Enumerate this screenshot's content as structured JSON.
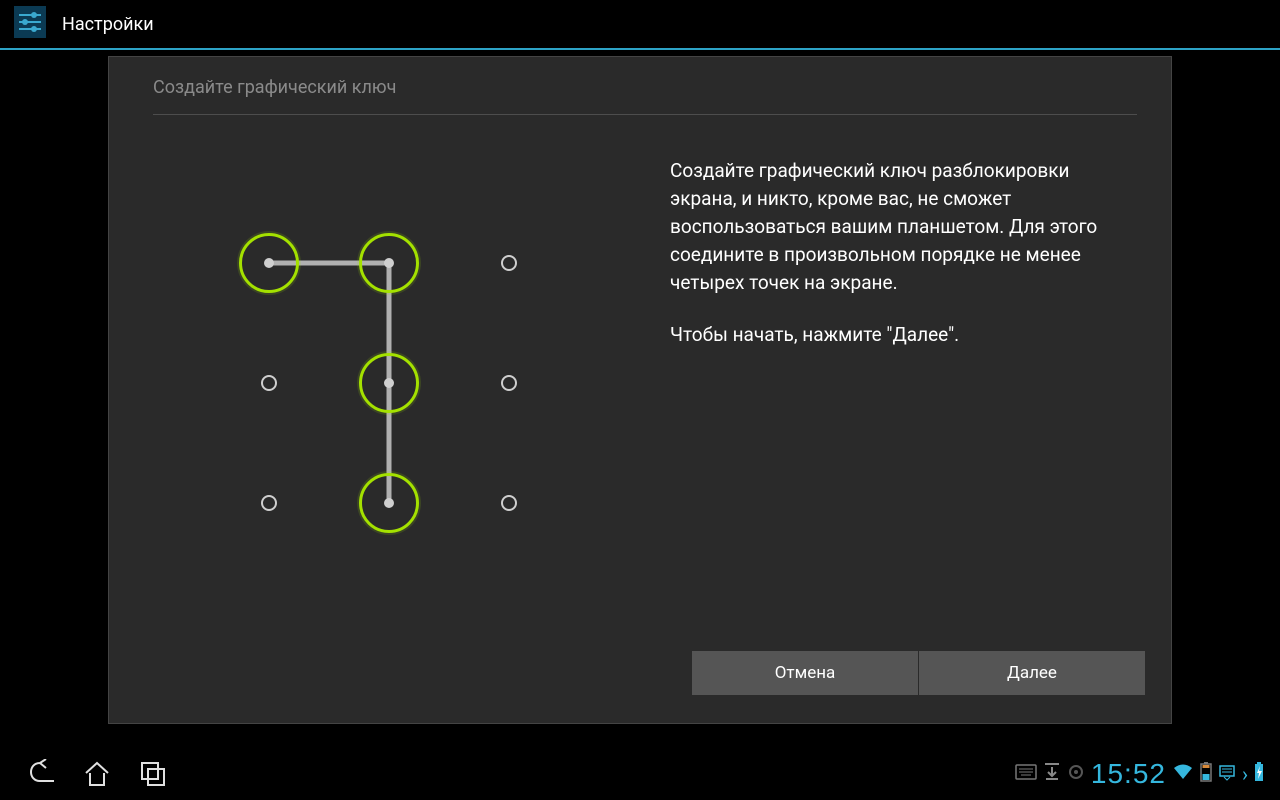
{
  "header": {
    "title": "Настройки"
  },
  "panel": {
    "heading": "Создайте графический ключ",
    "instruction1": "Создайте графический ключ разблокировки экрана, и никто, кроме вас, не сможет воспользоваться вашим планшетом. Для этого соедините в произвольном порядке не менее четырех точек на экране.",
    "instruction2": "Чтобы начать, нажмите \"Далее\"."
  },
  "buttons": {
    "cancel": "Отмена",
    "next": "Далее"
  },
  "pattern": {
    "grid": 3,
    "selected_indices": [
      0,
      1,
      4,
      7
    ],
    "path": [
      [
        0,
        0
      ],
      [
        1,
        0
      ],
      [
        1,
        1
      ],
      [
        1,
        2
      ]
    ]
  },
  "status": {
    "time": "15:52"
  },
  "colors": {
    "accent": "#a4e100",
    "holo_blue": "#35b7de"
  }
}
